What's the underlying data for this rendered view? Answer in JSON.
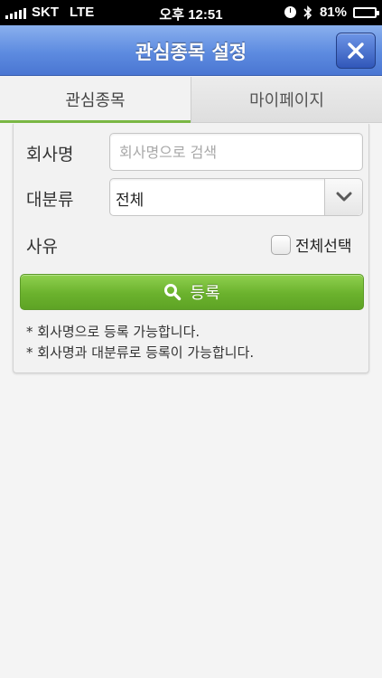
{
  "status_bar": {
    "carrier": "SKT",
    "network": "LTE",
    "time": "오후 12:51",
    "battery": "81%",
    "battery_level": 0.81,
    "icons": [
      "signal-icon",
      "alarm-icon",
      "bluetooth-icon",
      "battery-icon"
    ]
  },
  "header": {
    "title": "관심종목 설정",
    "close_icon": "close-icon"
  },
  "tabs": [
    {
      "label": "관심종목",
      "active": true
    },
    {
      "label": "마이페이지",
      "active": false
    }
  ],
  "form": {
    "company_label": "회사명",
    "company_placeholder": "회사명으로 검색",
    "company_value": "",
    "category_label": "대분류",
    "category_selected": "전체",
    "reason_label": "사유",
    "select_all_label": "전체선택",
    "select_all_checked": false,
    "register_label": "등록",
    "register_icon": "search-icon"
  },
  "notes": [
    "* 회사명으로 등록 가능합니다.",
    "* 회사명과 대분류로 등록이 가능합니다."
  ],
  "colors": {
    "header_blue": "#5d8be0",
    "close_button_blue": "#3157b9",
    "register_green": "#6bb22d",
    "active_tab_indicator": "#7ab744"
  }
}
